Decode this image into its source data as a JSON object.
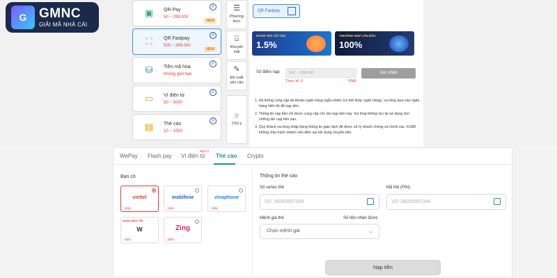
{
  "logo": {
    "mark": "G",
    "title": "GMNC",
    "subtitle": "GIẢI MÃ NHÀ CÁI"
  },
  "payment_methods": [
    {
      "name": "QR Pay",
      "range": "50 ~ 299.000",
      "badge": "NEW",
      "icon": "qr-scan-icon",
      "active": false
    },
    {
      "name": "QR Fastpay",
      "range": "500 ~ 299.000",
      "badge": "NEW",
      "icon": "qr-fast-icon",
      "active": true
    },
    {
      "name": "Tiền mã hóa",
      "range": "Không giới hạn",
      "badge": "",
      "icon": "crypto-icon",
      "active": false
    },
    {
      "name": "Ví điện tử",
      "range": "50 ~ 5000",
      "badge": "",
      "icon": "wallet-icon",
      "active": false
    },
    {
      "name": "Thẻ cào",
      "range": "10 ~ 1000",
      "badge": "",
      "icon": "card-icon",
      "active": false
    }
  ],
  "side_menu": [
    {
      "label": "Phương thức",
      "icon": "method-icon"
    },
    {
      "label": "Khuyến mãi",
      "icon": "gift-icon"
    },
    {
      "label": "Đề xuất yêu cầu",
      "icon": "edit-icon"
    },
    {
      "label": "Chú ý",
      "icon": "bulb-icon"
    }
  ],
  "selected_method": "QR Fastpay",
  "banners": [
    {
      "tag": "HOÀN TRẢ VÔ TẬN",
      "value": "1.5%"
    },
    {
      "tag": "THƯỞNG NẠP LẦN ĐẦU",
      "value": "100%"
    }
  ],
  "deposit": {
    "amount_label": "Số điểm nạp",
    "amount_placeholder": "500 ~ 299.000",
    "real_label": "Thực tế: 0",
    "currency": "VNĐ",
    "confirm": "Xác nhận"
  },
  "notes": [
    "1. Hệ thống cung cấp tài khoản ngân hàng ngẫu nhiên (có thể khác ngân hàng), vui lòng dựa vào ngân hàng hiển thị để nạp tiền.",
    "2. Thông tin nạp tiền chỉ được cung cấp cho lần nạp tiền này. Vui lòng không lưu lại sử dụng cho những lần nạp tiền sau.",
    "3. Quý khách vui lòng nhập đúng thông tin giao dịch để được xử lý nhanh chóng và chính xác. KU88 không chịu trách nhiệm nếu điền sai nội dung chuyển tiền."
  ],
  "bottom": {
    "tabs": [
      "WePay",
      "Flash pay",
      "Ví điện tử",
      "Thẻ cào",
      "Crypto"
    ],
    "active_tab": "Thẻ cào",
    "tab_badge": "Bảo trì",
    "you_have": "Bạn có",
    "carriers": [
      {
        "name": "viettel",
        "color": "#e53935",
        "pct": "12%",
        "tag": "",
        "selected": true
      },
      {
        "name": "mobifone",
        "color": "#1565c0",
        "pct": "13%",
        "tag": "",
        "selected": false
      },
      {
        "name": "vinaphone",
        "color": "#1e88e5",
        "pct": "13%",
        "tag": "",
        "selected": false
      },
      {
        "name": "W",
        "color": "#333333",
        "pct": "15%",
        "tag": "ĐANG BẢO TRÌ",
        "selected": false
      },
      {
        "name": "Zing",
        "color": "#e91e63",
        "pct": "20%",
        "tag": "",
        "selected": false
      }
    ],
    "card_info_title": "Thông tin thẻ cào",
    "serial_label": "Số series thẻ",
    "serial_placeholder": "VD: 08283937345",
    "pin_label": "Mã thẻ (PIN)",
    "pin_placeholder": "VD: 08283937345",
    "denomination_label": "Mệnh giá thẻ",
    "received_label": "Số tiền nhận được",
    "denomination_value": "Chọn mệnh giá",
    "submit": "Nạp tiền"
  }
}
